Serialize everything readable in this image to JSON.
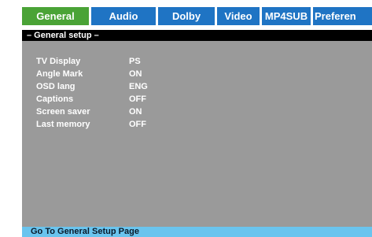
{
  "tabs": [
    {
      "label": "General",
      "active": true
    },
    {
      "label": "Audio",
      "active": false
    },
    {
      "label": "Dolby",
      "active": false
    },
    {
      "label": "Video",
      "active": false
    },
    {
      "label": "MP4SUB",
      "active": false
    },
    {
      "label": "Preferen",
      "active": false
    }
  ],
  "panel": {
    "title": "– General setup –",
    "settings": [
      {
        "label": "TV Display",
        "value": "PS"
      },
      {
        "label": "Angle Mark",
        "value": "ON"
      },
      {
        "label": "OSD lang",
        "value": "ENG"
      },
      {
        "label": "Captions",
        "value": "OFF"
      },
      {
        "label": "Screen saver",
        "value": "ON"
      },
      {
        "label": "Last memory",
        "value": "OFF"
      }
    ]
  },
  "status": {
    "text": "Go To General Setup Page"
  },
  "colors": {
    "active_tab": "#4aa336",
    "tab": "#1f74c4",
    "panel": "#9a9a9a",
    "header": "#000000",
    "status_bar": "#6ac4ee"
  }
}
